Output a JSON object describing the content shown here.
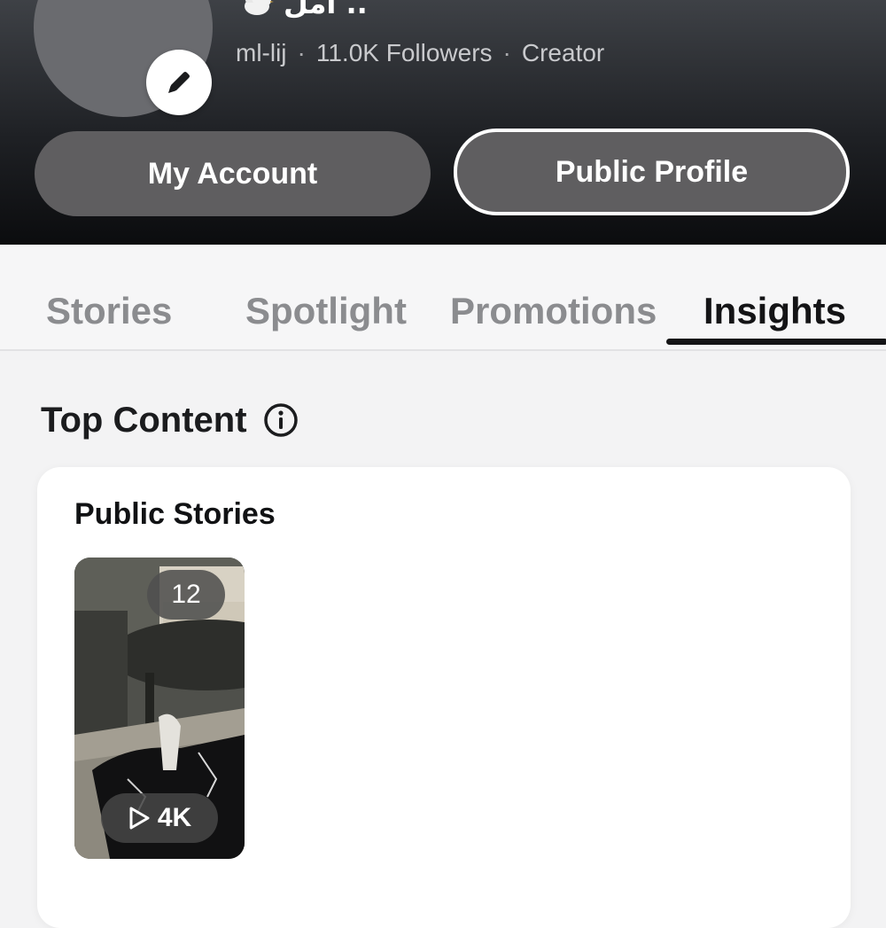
{
  "profile": {
    "name": "أمل ..",
    "username": "ml-lij",
    "followers": "11.0K Followers",
    "role": "Creator",
    "separator": "·"
  },
  "header": {
    "my_account_label": "My Account",
    "public_profile_label": "Public Profile"
  },
  "tabs": [
    {
      "label": "Stories",
      "active": false
    },
    {
      "label": "Spotlight",
      "active": false
    },
    {
      "label": "Promotions",
      "active": false
    },
    {
      "label": "Insights",
      "active": true
    }
  ],
  "top_content": {
    "title": "Top Content",
    "card": {
      "title": "Public Stories",
      "story": {
        "count": "12",
        "views": "4K"
      }
    }
  },
  "icons": {
    "avatar_placeholder": "image-icon",
    "edit": "pencil-icon",
    "info": "info-icon",
    "play": "play-icon",
    "name_emoji": "dove-icon"
  },
  "colors": {
    "header_dark": "#1f2125",
    "button_bg": "#5f5e60",
    "active_tab": "#141416",
    "inactive_tab": "#8b8c8f",
    "page_bg": "#f3f3f4"
  }
}
